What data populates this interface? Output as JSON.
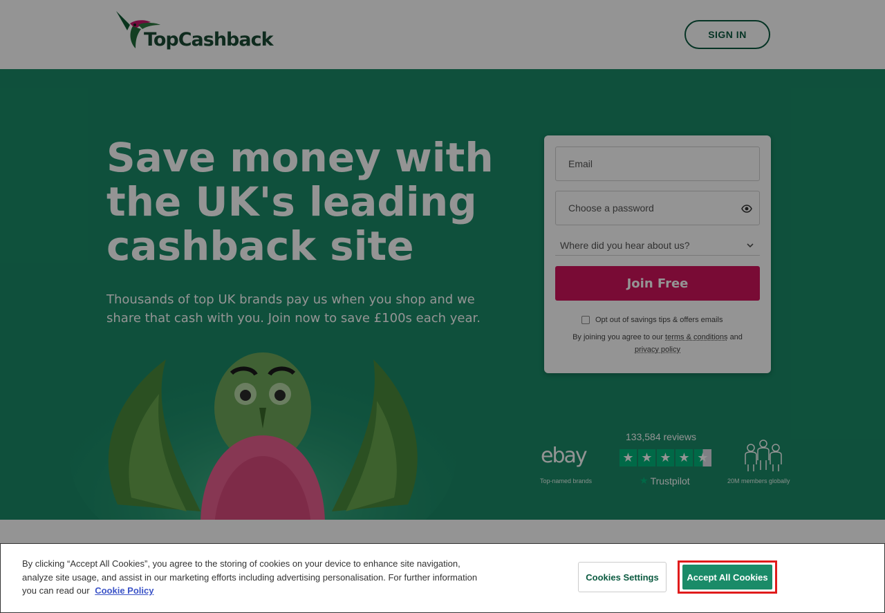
{
  "header": {
    "logo_text": "TopCashback",
    "signin_label": "SIGN IN"
  },
  "hero": {
    "headline": "Save money with the UK's leading cashback site",
    "subline": "Thousands of top UK brands pay us when you shop and we share that cash with you. Join now to save £100s each year."
  },
  "form": {
    "email_placeholder": "Email",
    "password_placeholder": "Choose a password",
    "referral_placeholder": "Where did you hear about us?",
    "join_label": "Join Free",
    "optout_label": "Opt out of savings tips & offers emails",
    "legal_prefix": "By joining you agree to our",
    "terms_link": "terms & conditions",
    "legal_and": "and",
    "privacy_link": "privacy policy"
  },
  "trust": {
    "ebay_logo": "ebay",
    "ebay_caption": "Top-named brands",
    "reviews": "133,584 reviews",
    "trustpilot": "Trustpilot",
    "rating_stars": 4.5,
    "members_caption": "20M members globally"
  },
  "cookie": {
    "text": "By clicking “Accept All Cookies”, you agree to the storing of cookies on your device to enhance site navigation, analyze site usage, and assist in our marketing efforts including advertising personalisation. For further information you can read our",
    "policy_link": "Cookie Policy",
    "settings_label": "Cookies Settings",
    "accept_label": "Accept All Cookies"
  },
  "colors": {
    "brand_green": "#1a8b68",
    "join_pink": "#d1135c",
    "trustpilot_green": "#00b67a",
    "highlight_red": "#e01b1b"
  },
  "icons": [
    "hummingbird-logo-icon",
    "eye-icon",
    "chevron-down-icon",
    "star-icon",
    "members-icon"
  ]
}
